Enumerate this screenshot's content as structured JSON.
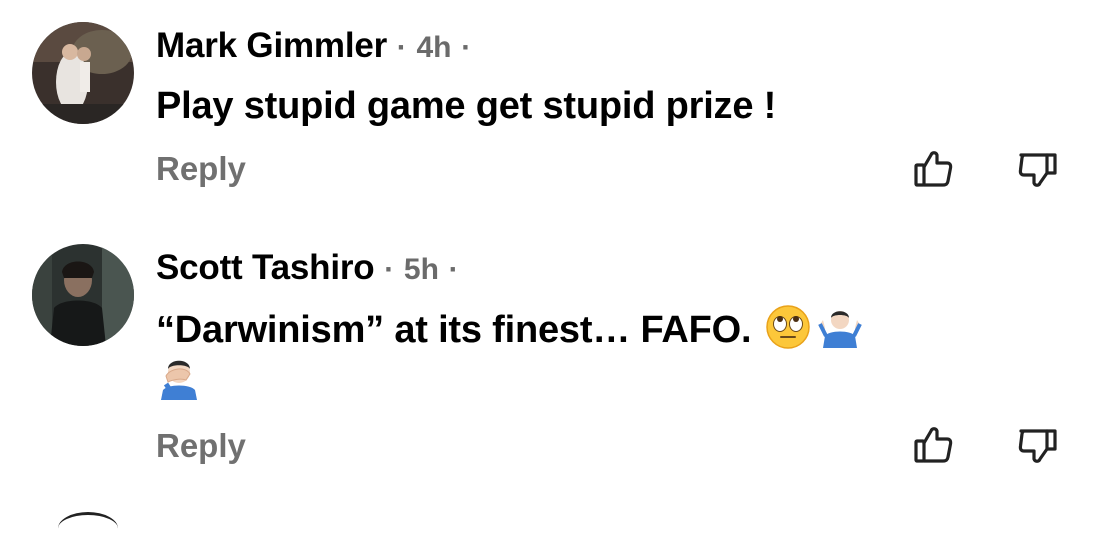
{
  "comments": [
    {
      "author": "Mark Gimmler",
      "time": "4h",
      "text": "Play stupid game get stupid prize !",
      "reply_label": "Reply"
    },
    {
      "author": "Scott Tashiro",
      "time": "5h",
      "text": "“Darwinism” at its finest… FAFO.",
      "emojis": [
        "eye-roll-emoji",
        "shrug-emoji",
        "facepalm-emoji"
      ],
      "reply_label": "Reply"
    }
  ],
  "separator": "·",
  "icons": {
    "like": "thumbs-up-icon",
    "dislike": "thumbs-down-icon"
  },
  "colors": {
    "text": "#000000",
    "meta": "#6b6b6b",
    "reply": "#707070"
  }
}
